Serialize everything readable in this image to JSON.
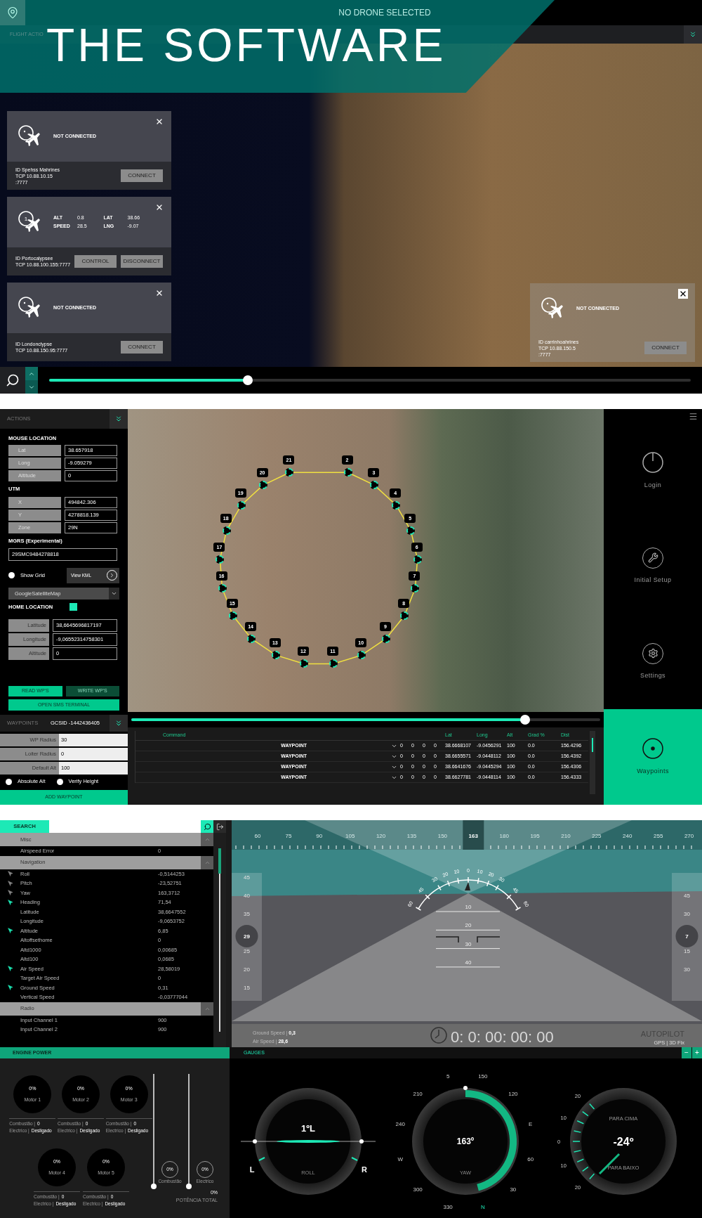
{
  "banner": {
    "title": "THE SOFTWARE"
  },
  "fleet_view": {
    "status": "NO DRONE SELECTED",
    "section": "FLIGHT ACTIO",
    "drones": [
      {
        "kind": "disconnected",
        "status": "NOT CONNECTED",
        "address": [
          "ID Spehss Mahrines",
          "TCP 10.88.10.15",
          ":7777"
        ],
        "buttons": [
          "CONNECT"
        ]
      },
      {
        "kind": "connected",
        "number": "1",
        "telemetry": [
          {
            "label": "ALT",
            "value": "0.8"
          },
          {
            "label": "LAT",
            "value": "38.66"
          },
          {
            "label": "SPEED",
            "value": "28.5"
          },
          {
            "label": "LNG",
            "value": "-9.07"
          }
        ],
        "address": [
          "ID Portocalypsee",
          "TCP  10.88.100.155:7777"
        ],
        "buttons": [
          "CONTROL",
          "DISCONNECT"
        ]
      },
      {
        "kind": "disconnected",
        "status": "NOT CONNECTED",
        "address": [
          "ID Londonclypse",
          "TCP  10.88.150.95:7777"
        ],
        "buttons": [
          "CONNECT"
        ]
      }
    ],
    "floating_drone": {
      "kind": "disconnected",
      "status": "NOT CONNECTED",
      "address": [
        "ID carrinhoahrines",
        "TCP 10.88.150.5",
        ":7777"
      ],
      "buttons": [
        "CONNECT"
      ]
    },
    "timeline": {
      "level": 0.31
    }
  },
  "mission_view": {
    "actions": {
      "title": "ACTIONS",
      "mouse_location": {
        "title": "MOUSE LOCATION",
        "fields": [
          {
            "label": "Lat",
            "value": "38.657918"
          },
          {
            "label": "Long",
            "value": "-9.059279"
          },
          {
            "label": "Altitude",
            "value": "0"
          }
        ]
      },
      "utm": {
        "title": "UTM",
        "fields": [
          {
            "label": "X",
            "value": "494842.306"
          },
          {
            "label": "Y",
            "value": "4278818.139"
          },
          {
            "label": "Zone",
            "value": "29N"
          }
        ]
      },
      "mgrs": {
        "title": "MGRS (Experimental)",
        "value": "29SMC9484278818"
      },
      "show_grid": {
        "label": "Show Grid",
        "checked": false
      },
      "view_kml": "View KML",
      "map_select": "GoogleSatelliteMap",
      "home_location": {
        "title": "HOME LOCATION",
        "checked": true,
        "fields": [
          {
            "label": "Latitude",
            "value": "38,6645696817197"
          },
          {
            "label": "Longitude",
            "value": "-9,06552314758301"
          },
          {
            "label": "Altitude",
            "value": "0"
          }
        ]
      },
      "buttons": [
        {
          "label": "READ WP'S",
          "primary": true
        },
        {
          "label": "WRITE WP'S",
          "primary": false
        }
      ],
      "sms_button": "OPEN SMS TERMINAL"
    },
    "waypoints_panel": {
      "title": "WAYPOINTS",
      "gcs_id": "GCSID -1442436405",
      "fields": [
        {
          "label": "WP Radius",
          "value": "30"
        },
        {
          "label": "Loiter Radius",
          "value": "0"
        },
        {
          "label": "Default Alt",
          "value": "100"
        }
      ],
      "options": [
        {
          "label": "Absolute Alt",
          "checked": false
        },
        {
          "label": "Verify Height",
          "checked": false
        }
      ],
      "add_button": "ADD WAYPOINT"
    },
    "map": {
      "pins": [
        "2",
        "3",
        "4",
        "5",
        "6",
        "7",
        "8",
        "9",
        "10",
        "11",
        "12",
        "13",
        "14",
        "15",
        "16",
        "17",
        "18",
        "19",
        "20",
        "21"
      ]
    },
    "timeline": {
      "level": 0.84
    },
    "table": {
      "columns": [
        "Command",
        "Lat",
        "Long",
        "Alt",
        "Grad %",
        "Dist"
      ],
      "rows": [
        {
          "command": "WAYPOINT",
          "params": [
            "0",
            "0",
            "0",
            "0"
          ],
          "lat": "38.6668107",
          "long": "-9.0456291",
          "alt": "100",
          "grad": "0.0",
          "dist": "156.4296"
        },
        {
          "command": "WAYPOINT",
          "params": [
            "0",
            "0",
            "0",
            "0"
          ],
          "lat": "38.6655571",
          "long": "-9.0448112",
          "alt": "100",
          "grad": "0.0",
          "dist": "156.4392"
        },
        {
          "command": "WAYPOINT",
          "params": [
            "0",
            "0",
            "0",
            "0"
          ],
          "lat": "38.6641676",
          "long": "-9.0445294",
          "alt": "100",
          "grad": "0.0",
          "dist": "156.4306"
        },
        {
          "command": "WAYPOINT",
          "params": [
            "0",
            "0",
            "0",
            "0"
          ],
          "lat": "38.6627781",
          "long": "-9.0448114",
          "alt": "100",
          "grad": "0.0",
          "dist": "156.4333"
        }
      ]
    },
    "nav": [
      {
        "label": "Login",
        "kind": "power",
        "selected": false
      },
      {
        "label": "Initial Setup",
        "kind": "wrench",
        "selected": false
      },
      {
        "label": "Settings",
        "kind": "gear",
        "selected": false
      },
      {
        "label": "Waypoints",
        "kind": "target",
        "selected": true
      }
    ]
  },
  "cockpit_view": {
    "search": {
      "label": "SEARCH"
    },
    "groups": [
      {
        "title": "Misc",
        "expanded": true,
        "items": [
          {
            "name": "Airspeed Error",
            "value": "0",
            "kind": "plain"
          }
        ]
      },
      {
        "title": "Navigation",
        "expanded": true,
        "items": [
          {
            "name": "Roll",
            "value": "-0,5144253",
            "kind": "tracked"
          },
          {
            "name": "Pitch",
            "value": "-23,52751",
            "kind": "tracked"
          },
          {
            "name": "Yaw",
            "value": "163,3712",
            "kind": "tracked"
          },
          {
            "name": "Heading",
            "value": "71,54",
            "kind": "active"
          },
          {
            "name": "Latitude",
            "value": "38,6647552",
            "kind": "plain"
          },
          {
            "name": "Longitude",
            "value": "-9,0653752",
            "kind": "plain"
          },
          {
            "name": "Altitude",
            "value": "6,85",
            "kind": "active"
          },
          {
            "name": "Altoffsethome",
            "value": "0",
            "kind": "plain"
          },
          {
            "name": "Altd1000",
            "value": "0,00685",
            "kind": "plain"
          },
          {
            "name": "Altd100",
            "value": "0,0685",
            "kind": "plain"
          },
          {
            "name": "Air Speed",
            "value": "28,58019",
            "kind": "active"
          },
          {
            "name": "Target Air Speed",
            "value": "0",
            "kind": "plain"
          },
          {
            "name": "Ground Speed",
            "value": "0,31",
            "kind": "active"
          },
          {
            "name": "Vertical Speed",
            "value": "-0,03777044",
            "kind": "plain"
          }
        ]
      },
      {
        "title": "Radio",
        "expanded": true,
        "items": [
          {
            "name": "Input Channel 1",
            "value": "900",
            "kind": "plain"
          },
          {
            "name": "Input Channel 2",
            "value": "900",
            "kind": "plain"
          }
        ]
      }
    ],
    "horizon": {
      "heading_scale": [
        {
          "label": "60",
          "selected": false
        },
        {
          "label": "75",
          "selected": false
        },
        {
          "label": "90",
          "selected": false
        },
        {
          "label": "105",
          "selected": false
        },
        {
          "label": "120",
          "selected": false
        },
        {
          "label": "135",
          "selected": false
        },
        {
          "label": "150",
          "selected": false
        },
        {
          "label": "163",
          "selected": true
        },
        {
          "label": "180",
          "selected": false
        },
        {
          "label": "195",
          "selected": false
        },
        {
          "label": "210",
          "selected": false
        },
        {
          "label": "225",
          "selected": false
        },
        {
          "label": "240",
          "selected": false
        },
        {
          "label": "255",
          "selected": false
        },
        {
          "label": "270",
          "selected": false
        }
      ],
      "left_tape": {
        "above": [
          "45",
          "40",
          "35"
        ],
        "current": "29",
        "below": [
          "25",
          "20",
          "15"
        ]
      },
      "right_tape": {
        "above": [
          "45",
          "30"
        ],
        "current": "7",
        "below": [
          "15",
          "30"
        ]
      },
      "roll_scale": [
        "60",
        "45",
        "30",
        "20",
        "10",
        "0",
        "10",
        "20",
        "30",
        "45",
        "60"
      ],
      "pitch_ladder": [
        "10",
        "20",
        "30",
        "40"
      ],
      "ground_speed": {
        "label": "Ground Speed |",
        "value": "0,3"
      },
      "air_speed": {
        "label": "Air Speed |",
        "value": "28,6"
      },
      "timer": "0: 0: 00: 00: 00",
      "mode": "AUTOPILOT",
      "gps": "GPS | 3D Fix"
    }
  },
  "engine_power": {
    "title": "ENGINE POWER",
    "motors": [
      {
        "value": "0%",
        "name": "Motor 1",
        "stats": [
          {
            "label": "Combustão |",
            "value": "0"
          },
          {
            "label": "Electrico |",
            "value": "Desligado"
          }
        ]
      },
      {
        "value": "0%",
        "name": "Motor 2",
        "stats": [
          {
            "label": "Combustão |",
            "value": "0"
          },
          {
            "label": "Electrico |",
            "value": "Desligado"
          }
        ]
      },
      {
        "value": "0%",
        "name": "Motor 3",
        "stats": [
          {
            "label": "Combustão |",
            "value": "0"
          },
          {
            "label": "Electrico |",
            "value": "Desligado"
          }
        ]
      },
      {
        "value": "0%",
        "name": "Motor 4",
        "stats": [
          {
            "label": "Combustão |",
            "value": "0"
          },
          {
            "label": "Electrico |",
            "value": "Desligado"
          }
        ]
      },
      {
        "value": "0%",
        "name": "Motor 5",
        "stats": [
          {
            "label": "Combustão |",
            "value": "0"
          },
          {
            "label": "Electrico |",
            "value": "Desligado"
          }
        ]
      }
    ],
    "sliders": [
      {
        "value": "0%",
        "label": "Combustão",
        "level": 0
      },
      {
        "value": "0%",
        "label": "Electrico",
        "level": 0
      }
    ],
    "total": {
      "value": "0%",
      "label": "POTÊNCIA TOTAL"
    }
  },
  "gauges": {
    "title": "GAUGES",
    "buttons": [
      "−",
      "+"
    ],
    "roll": {
      "value": "1ºL",
      "label": "ROLL",
      "left": "L",
      "right": "R"
    },
    "yaw": {
      "value": "163º",
      "label": "YAW",
      "scale": [
        "5",
        "150",
        "120",
        "E",
        "60",
        "30",
        "N",
        "330",
        "300",
        "W",
        "240",
        "210"
      ]
    },
    "pitch": {
      "up": "PARA CIMA",
      "value": "-24º",
      "down": "PARA BAIXO",
      "scale": [
        "20",
        "10",
        "0",
        "10",
        "20"
      ]
    }
  }
}
